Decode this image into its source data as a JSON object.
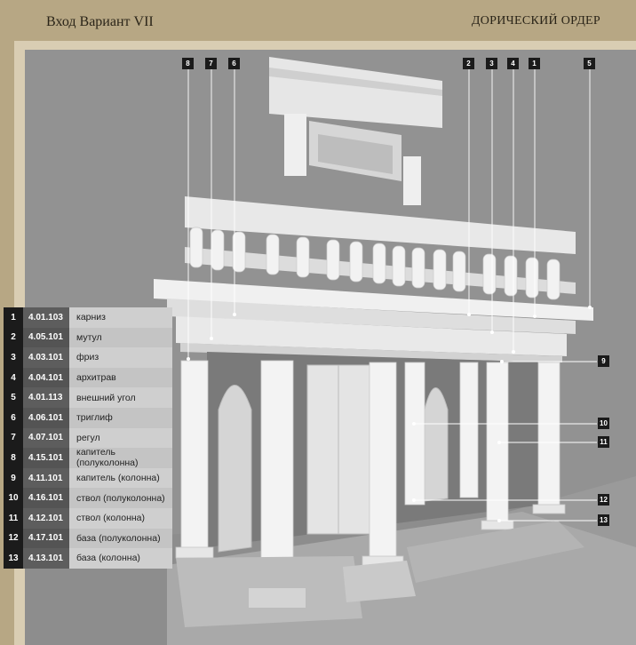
{
  "header": {
    "left_title": "Вход Вариант VII",
    "right_title": "ДОРИЧЕСКИЙ ОРДЕР"
  },
  "legend": [
    {
      "num": "1",
      "code": "4.01.103",
      "name": "карниз"
    },
    {
      "num": "2",
      "code": "4.05.101",
      "name": "мутул"
    },
    {
      "num": "3",
      "code": "4.03.101",
      "name": "фриз"
    },
    {
      "num": "4",
      "code": "4.04.101",
      "name": "архитрав"
    },
    {
      "num": "5",
      "code": "4.01.113",
      "name": "внешний угол"
    },
    {
      "num": "6",
      "code": "4.06.101",
      "name": "триглиф"
    },
    {
      "num": "7",
      "code": "4.07.101",
      "name": "регул"
    },
    {
      "num": "8",
      "code": "4.15.101",
      "name": "капитель (полуколонна)"
    },
    {
      "num": "9",
      "code": "4.11.101",
      "name": "капитель (колонна)"
    },
    {
      "num": "10",
      "code": "4.16.101",
      "name": "ствол (полуколонна)"
    },
    {
      "num": "11",
      "code": "4.12.101",
      "name": "ствол (колонна)"
    },
    {
      "num": "12",
      "code": "4.17.101",
      "name": "база (полуколонна)"
    },
    {
      "num": "13",
      "code": "4.13.101",
      "name": "база (колонна)"
    }
  ],
  "callouts": [
    "8",
    "7",
    "6",
    "2",
    "3",
    "4",
    "1",
    "5",
    "9",
    "10",
    "11",
    "12",
    "13"
  ],
  "colors": {
    "frame": "#b7a784",
    "callout_bg": "#1b1b1b",
    "code_bg": "#5d5d5d",
    "name_bg": "#cfcfcf"
  }
}
